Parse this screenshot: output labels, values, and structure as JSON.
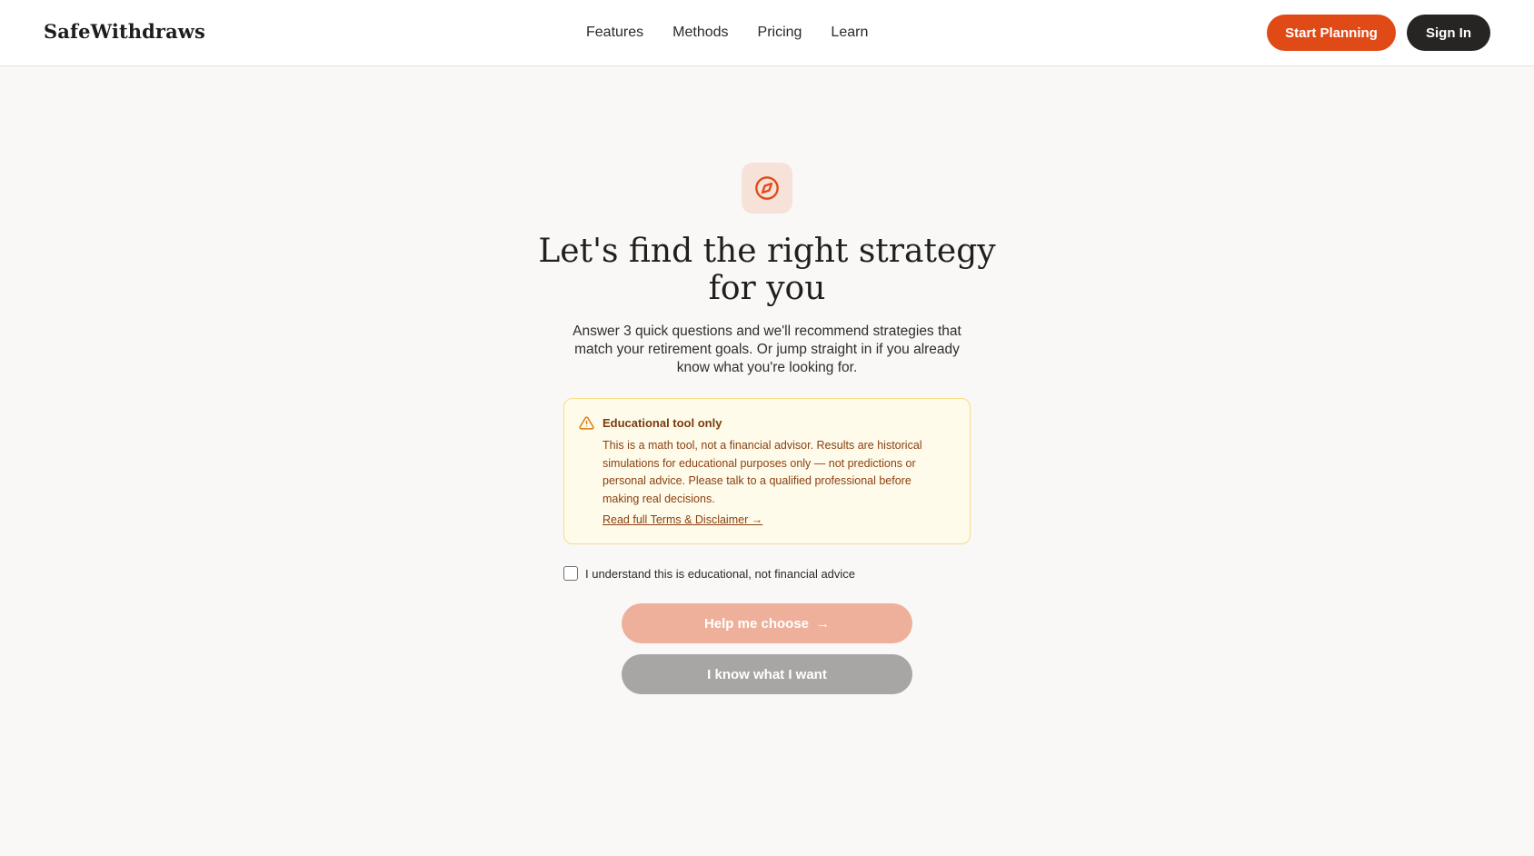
{
  "header": {
    "brand": "SafeWithdraws",
    "nav": [
      {
        "label": "Features"
      },
      {
        "label": "Methods"
      },
      {
        "label": "Pricing"
      },
      {
        "label": "Learn"
      }
    ],
    "start_planning_label": "Start Planning",
    "sign_in_label": "Sign In"
  },
  "hero": {
    "icon": "compass-icon",
    "title": "Let's find the right strategy for you",
    "subtitle": "Answer 3 quick questions and we'll recommend strategies that match your retirement goals. Or jump straight in if you already know what you're looking for."
  },
  "notice": {
    "icon": "warning-triangle-icon",
    "title": "Educational tool only",
    "body": "This is a math tool, not a financial advisor. Results are historical simulations for educational purposes only — not predictions or personal advice. Please talk to a qualified professional before making real decisions.",
    "link_label": "Read full Terms & Disclaimer →"
  },
  "consent": {
    "label": "I understand this is educational, not financial advice",
    "checked": false
  },
  "actions": {
    "help_label": "Help me choose",
    "help_arrow": "→",
    "know_label": "I know what I want"
  },
  "colors": {
    "accent": "#e04a17",
    "dark": "#262524",
    "notice_bg": "#fffbea",
    "notice_border": "#f5dc8a",
    "disabled_primary": "#eeb09a",
    "disabled_secondary": "#a7a6a4"
  }
}
